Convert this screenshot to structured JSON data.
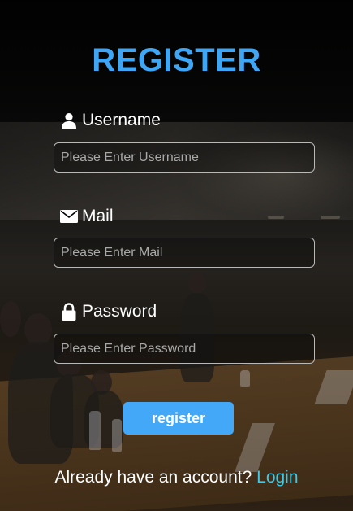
{
  "form": {
    "title": "REGISTER",
    "title_color": "#3fa6f6",
    "fields": [
      {
        "label": "Username",
        "icon": "user-icon",
        "placeholder": "Please Enter Username",
        "value": ""
      },
      {
        "label": "Mail",
        "icon": "mail-icon",
        "placeholder": "Please Enter Mail",
        "value": ""
      },
      {
        "label": "Password",
        "icon": "lock-icon",
        "placeholder": "Please Enter Password",
        "value": ""
      }
    ],
    "submit_label": "register",
    "submit_color": "#43a8f8",
    "footer_text": "Already have an account?",
    "login_link_label": "Login",
    "login_link_color": "#3ec9e6"
  }
}
